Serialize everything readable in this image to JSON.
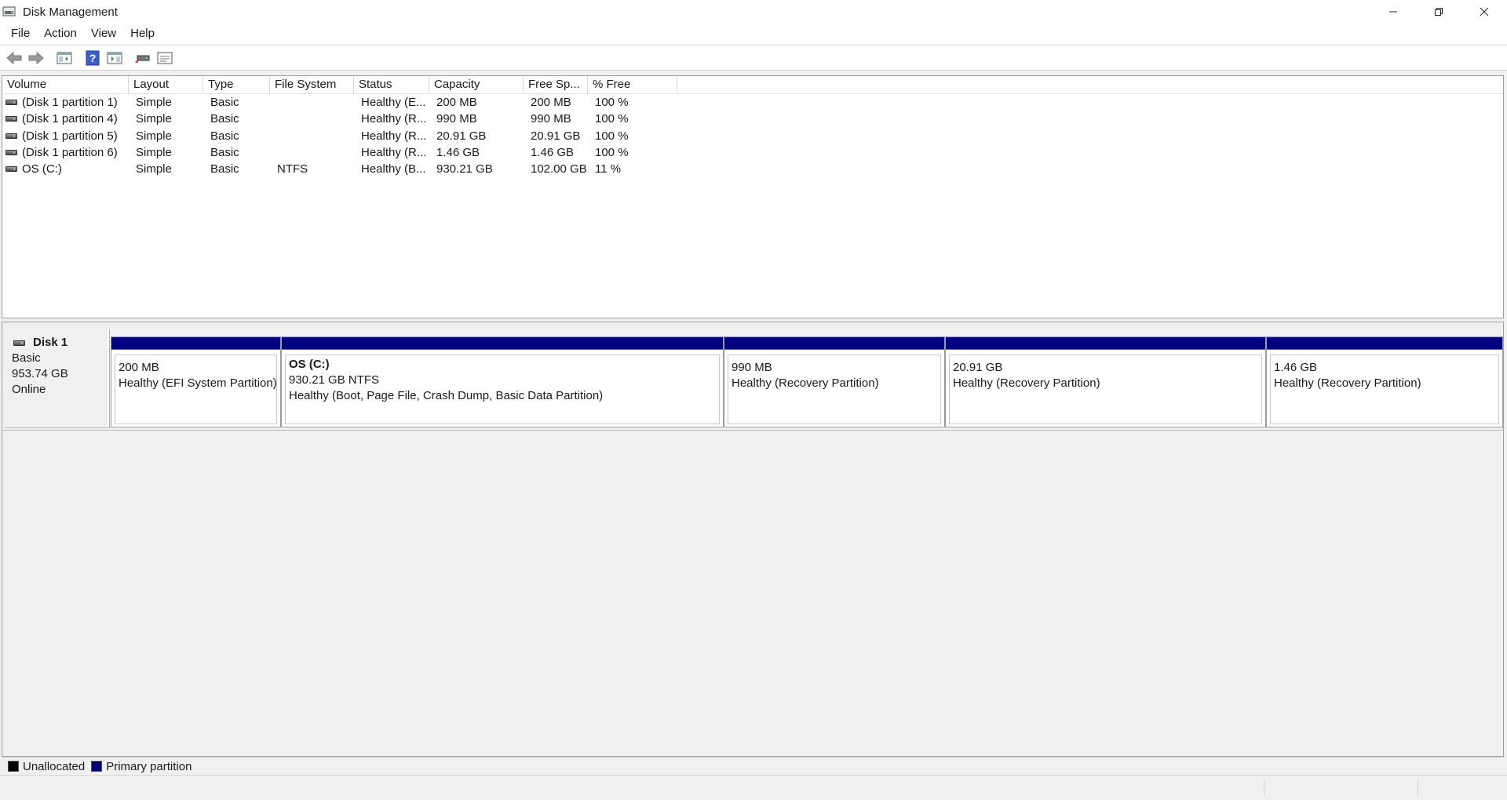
{
  "window": {
    "title": "Disk Management",
    "minimize_glyph": "—",
    "restore_glyph": "❐",
    "close_glyph": "✕"
  },
  "menu": [
    "File",
    "Action",
    "View",
    "Help"
  ],
  "toolbar": {
    "icons": [
      "back-arrow-icon",
      "forward-arrow-icon",
      "show-hide-console-tree-icon",
      "help-icon",
      "show-hide-action-pane-icon",
      "connect-drive-icon",
      "properties-icon"
    ]
  },
  "volume_table": {
    "columns": [
      "Volume",
      "Layout",
      "Type",
      "File System",
      "Status",
      "Capacity",
      "Free Sp...",
      "% Free"
    ],
    "rows": [
      [
        "(Disk 1 partition 1)",
        "Simple",
        "Basic",
        "",
        "Healthy (E...",
        "200 MB",
        "200 MB",
        "100 %"
      ],
      [
        "(Disk 1 partition 4)",
        "Simple",
        "Basic",
        "",
        "Healthy (R...",
        "990 MB",
        "990 MB",
        "100 %"
      ],
      [
        "(Disk 1 partition 5)",
        "Simple",
        "Basic",
        "",
        "Healthy (R...",
        "20.91 GB",
        "20.91 GB",
        "100 %"
      ],
      [
        "(Disk 1 partition 6)",
        "Simple",
        "Basic",
        "",
        "Healthy (R...",
        "1.46 GB",
        "1.46 GB",
        "100 %"
      ],
      [
        "OS (C:)",
        "Simple",
        "Basic",
        "NTFS",
        "Healthy (B...",
        "930.21 GB",
        "102.00 GB",
        "11 %"
      ]
    ]
  },
  "disk": {
    "name": "Disk 1",
    "type": "Basic",
    "size": "953.74 GB",
    "state": "Online",
    "partitions": [
      {
        "name": "",
        "size": "200 MB",
        "status": "Healthy (EFI System Partition)"
      },
      {
        "name": "OS  (C:)",
        "size": "930.21 GB NTFS",
        "status": "Healthy (Boot, Page File, Crash Dump, Basic Data Partition)"
      },
      {
        "name": "",
        "size": "990 MB",
        "status": "Healthy (Recovery Partition)"
      },
      {
        "name": "",
        "size": "20.91 GB",
        "status": "Healthy (Recovery Partition)"
      },
      {
        "name": "",
        "size": "1.46 GB",
        "status": "Healthy (Recovery Partition)"
      }
    ]
  },
  "legend": [
    {
      "label": "Unallocated",
      "color": "#000000"
    },
    {
      "label": "Primary partition",
      "color": "#000080"
    }
  ],
  "colors": {
    "primary_partition": "#000080",
    "unallocated": "#000000"
  }
}
